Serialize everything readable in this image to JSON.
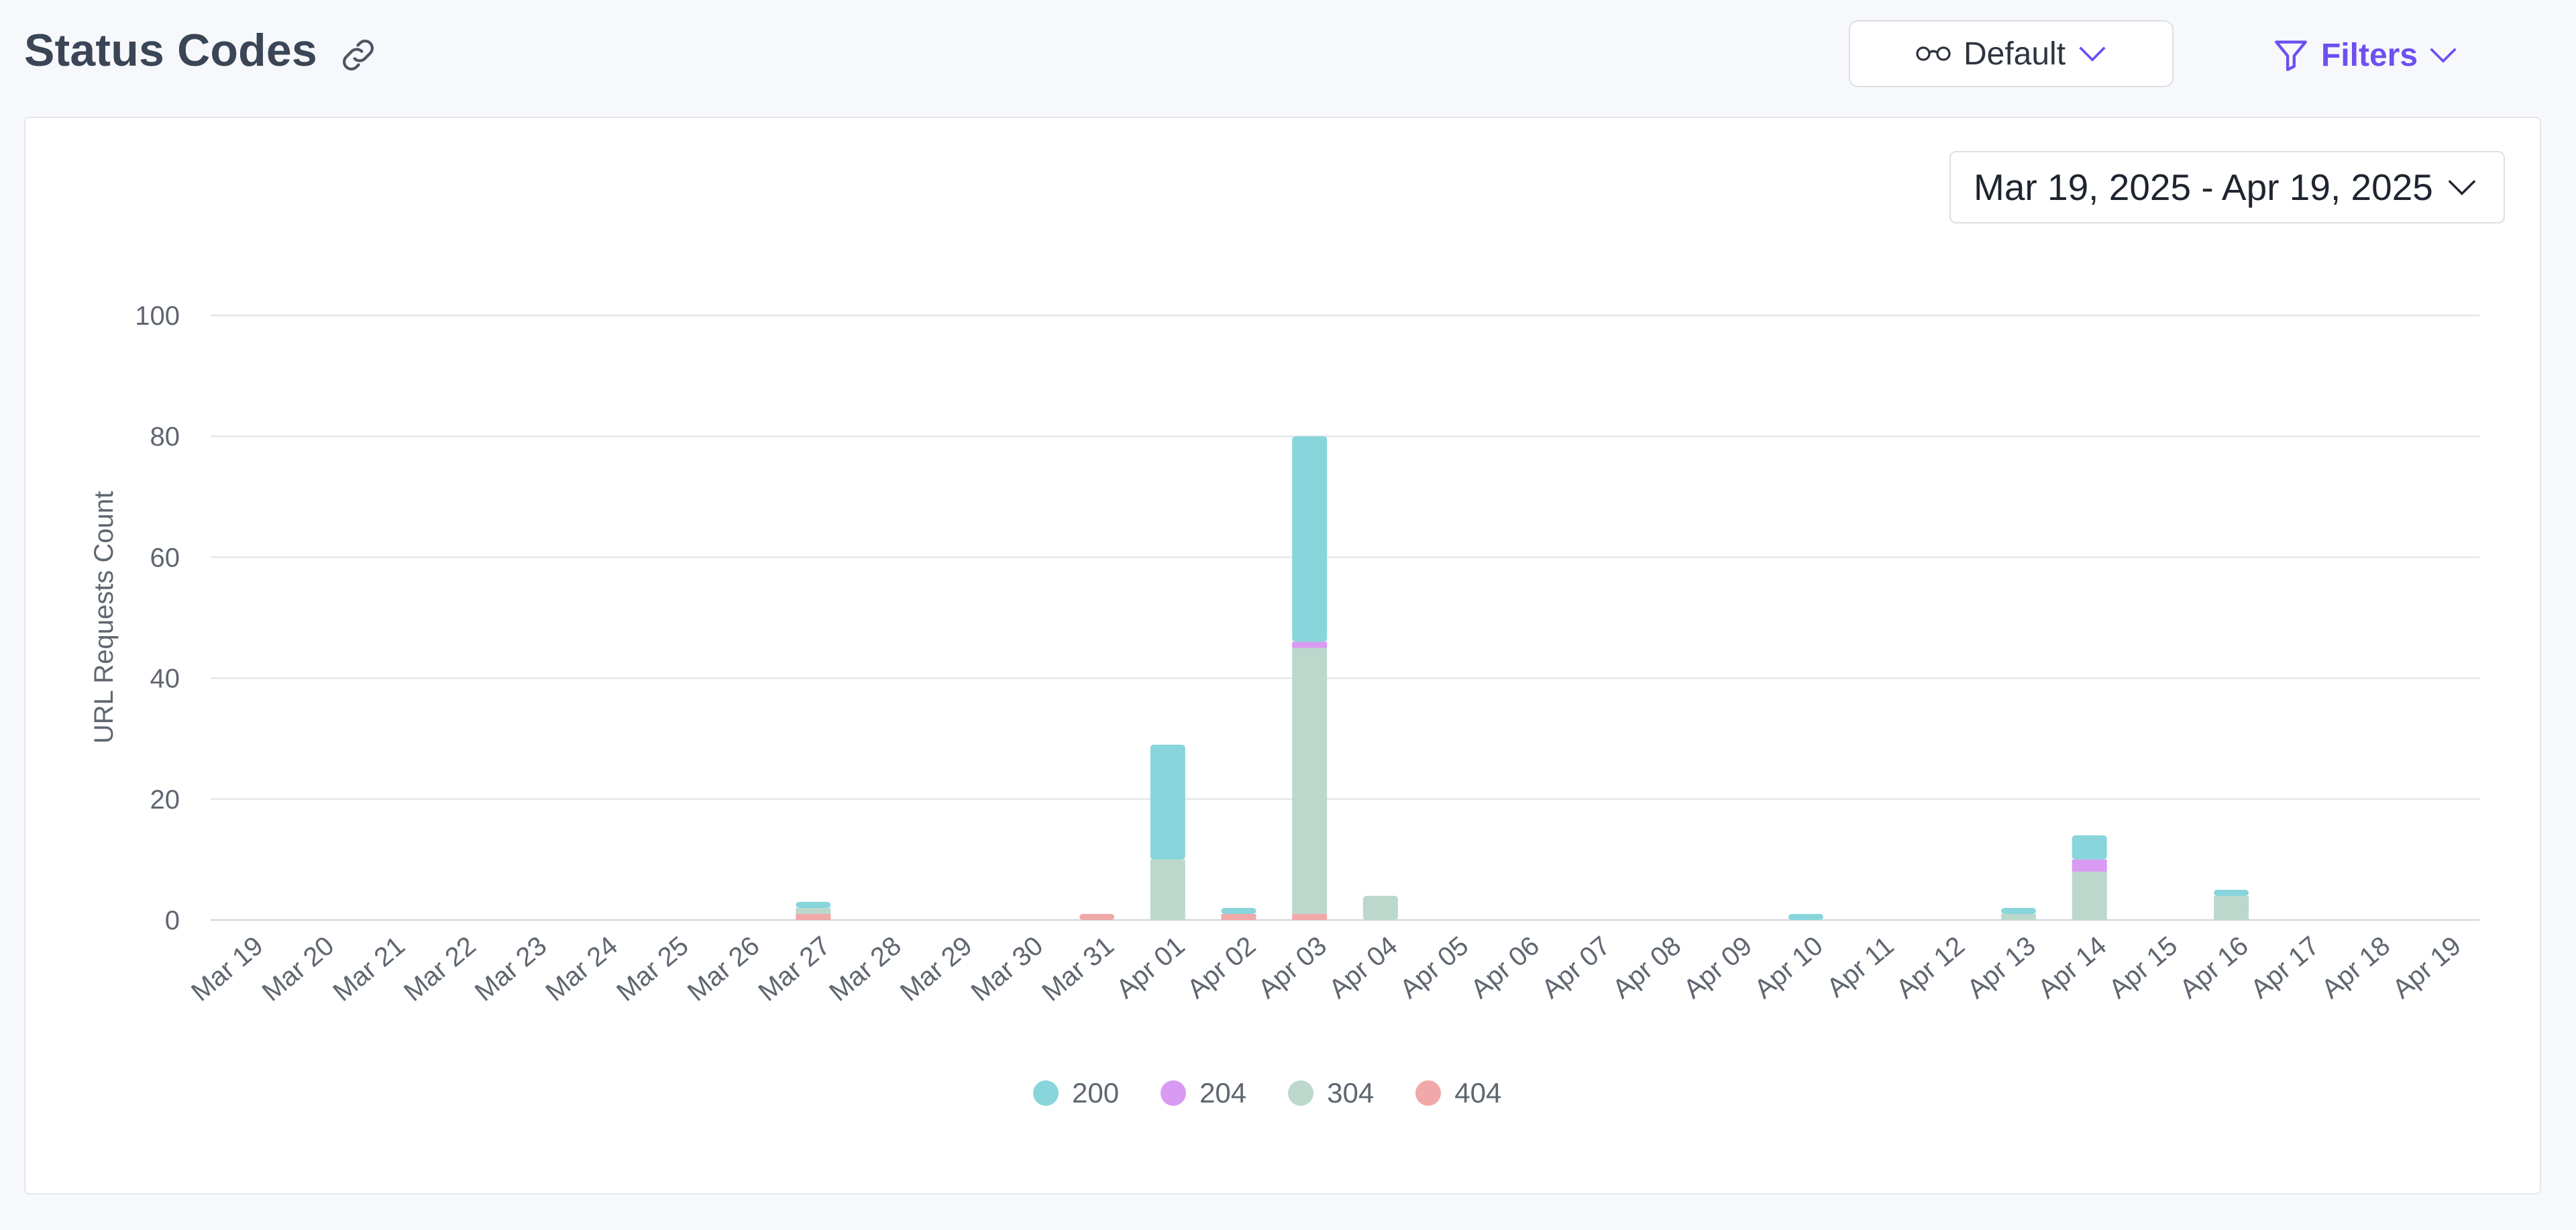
{
  "header": {
    "title": "Status Codes",
    "view_label": "Default",
    "filters_label": "Filters"
  },
  "date_range": {
    "label": "Mar 19, 2025 - Apr 19, 2025"
  },
  "icons": {
    "link": "link-icon",
    "view": "glasses-icon",
    "filter": "filter-icon",
    "chevron": "chevron-down-icon"
  },
  "colors": {
    "accent": "#6e4ff0",
    "title": "#3a4656"
  },
  "chart_data": {
    "type": "bar",
    "stacked": true,
    "ylabel": "URL Requests Count",
    "xlabel": "",
    "ylim": [
      0,
      100
    ],
    "yticks": [
      0,
      20,
      40,
      60,
      80,
      100
    ],
    "grid": true,
    "legend_position": "bottom-center",
    "categories": [
      "Mar 19",
      "Mar 20",
      "Mar 21",
      "Mar 22",
      "Mar 23",
      "Mar 24",
      "Mar 25",
      "Mar 26",
      "Mar 27",
      "Mar 28",
      "Mar 29",
      "Mar 30",
      "Mar 31",
      "Apr 01",
      "Apr 02",
      "Apr 03",
      "Apr 04",
      "Apr 05",
      "Apr 06",
      "Apr 07",
      "Apr 08",
      "Apr 09",
      "Apr 10",
      "Apr 11",
      "Apr 12",
      "Apr 13",
      "Apr 14",
      "Apr 15",
      "Apr 16",
      "Apr 17",
      "Apr 18",
      "Apr 19"
    ],
    "series": [
      {
        "name": "404",
        "color": "#f0a8a8",
        "values": [
          0,
          0,
          0,
          0,
          0,
          0,
          0,
          0,
          1,
          0,
          0,
          0,
          1,
          0,
          1,
          1,
          0,
          0,
          0,
          0,
          0,
          0,
          0,
          0,
          0,
          0,
          0,
          0,
          0,
          0,
          0,
          0
        ]
      },
      {
        "name": "304",
        "color": "#bcd8cc",
        "values": [
          0,
          0,
          0,
          0,
          0,
          0,
          0,
          0,
          1,
          0,
          0,
          0,
          0,
          10,
          0,
          44,
          4,
          0,
          0,
          0,
          0,
          0,
          0,
          0,
          0,
          1,
          8,
          0,
          4,
          0,
          0,
          0
        ]
      },
      {
        "name": "204",
        "color": "#d89af2",
        "values": [
          0,
          0,
          0,
          0,
          0,
          0,
          0,
          0,
          0,
          0,
          0,
          0,
          0,
          0,
          0,
          1,
          0,
          0,
          0,
          0,
          0,
          0,
          0,
          0,
          0,
          0,
          2,
          0,
          0,
          0,
          0,
          0
        ]
      },
      {
        "name": "200",
        "color": "#88d5dc",
        "values": [
          0,
          0,
          0,
          0,
          0,
          0,
          0,
          0,
          1,
          0,
          0,
          0,
          0,
          19,
          1,
          34,
          0,
          0,
          0,
          0,
          0,
          0,
          1,
          0,
          0,
          1,
          4,
          0,
          1,
          0,
          0,
          0
        ]
      }
    ],
    "legend_order": [
      "200",
      "204",
      "304",
      "404"
    ]
  }
}
